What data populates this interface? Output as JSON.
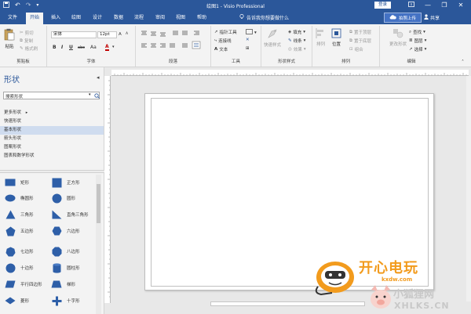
{
  "titlebar": {
    "title": "绘图1 - Visio Professional",
    "login_label": "登录",
    "min_glyph": "—",
    "restore_glyph": "❐",
    "close_glyph": "✕"
  },
  "menu": {
    "tabs": [
      "文件",
      "开始",
      "插入",
      "绘图",
      "设计",
      "数据",
      "流程",
      "审阅",
      "视图",
      "帮助"
    ],
    "active_tab": "开始",
    "tell_me": "告诉我你想要做什么",
    "upload_label": "拍照上传",
    "share_label": "共享"
  },
  "ribbon": {
    "clipboard": {
      "paste": "粘贴",
      "cut": "剪切",
      "copy": "复制",
      "format_painter": "格式刷",
      "label": "剪贴板"
    },
    "font": {
      "font_name": "宋体",
      "font_size": "12pt",
      "bold": "B",
      "italic": "I",
      "underline": "U",
      "strike": "abc",
      "case": "Aa",
      "color_glyph": "A",
      "grow_glyph": "A",
      "label": "字体"
    },
    "paragraph": {
      "label": "段落"
    },
    "tools": {
      "pointer": "指针工具",
      "connector": "连接线",
      "text": "文本",
      "label": "工具"
    },
    "shape_styles": {
      "quick_styles": "快速样式",
      "fill": "填充",
      "line": "线条",
      "effects": "效果",
      "label": "形状样式"
    },
    "arrange": {
      "align": "排列",
      "position": "位置",
      "bring_front": "置于顶层",
      "send_back": "置于底层",
      "group": "组合",
      "label": "排列"
    },
    "editing": {
      "change_shape": "更改形状",
      "find": "查找",
      "layers": "图层",
      "select": "选择",
      "label": "编辑"
    }
  },
  "shapes_pane": {
    "title": "形状",
    "search_placeholder": "搜索形状",
    "stencils": [
      "更多形状",
      "快速形状",
      "基本形状",
      "箭头形状",
      "图案形状",
      "图表和数学形状"
    ],
    "selected_stencil": "基本形状",
    "shapes": [
      {
        "icon": "rectangle-icon",
        "label": "矩形"
      },
      {
        "icon": "square-icon",
        "label": "正方形"
      },
      {
        "icon": "ellipse-icon",
        "label": "椭圆形"
      },
      {
        "icon": "circle-icon",
        "label": "圆形"
      },
      {
        "icon": "triangle-icon",
        "label": "三角形"
      },
      {
        "icon": "right-triangle-icon",
        "label": "直角三角形"
      },
      {
        "icon": "pentagon-icon",
        "label": "五边形"
      },
      {
        "icon": "hexagon-icon",
        "label": "六边形"
      },
      {
        "icon": "heptagon-icon",
        "label": "七边形"
      },
      {
        "icon": "octagon-icon",
        "label": "八边形"
      },
      {
        "icon": "decagon-icon",
        "label": "十边形"
      },
      {
        "icon": "can-icon",
        "label": "圆柱形"
      },
      {
        "icon": "parallelogram-icon",
        "label": "平行四边形"
      },
      {
        "icon": "trapezoid-icon",
        "label": "梯形"
      },
      {
        "icon": "diamond-icon",
        "label": "菱形"
      },
      {
        "icon": "cross-icon",
        "label": "十字形"
      }
    ]
  },
  "watermark": {
    "brand": "开心电玩",
    "site": "kxdw.com",
    "cn": "小狐狸网",
    "en": "XHLKS.CN"
  },
  "colors": {
    "accent": "#2b579a",
    "shape_fill": "#2e5fa8",
    "ribbon_bg": "#f3f3f3",
    "selected_stencil_bg": "#cfdcef",
    "watermark_orange": "#f29b1d"
  }
}
